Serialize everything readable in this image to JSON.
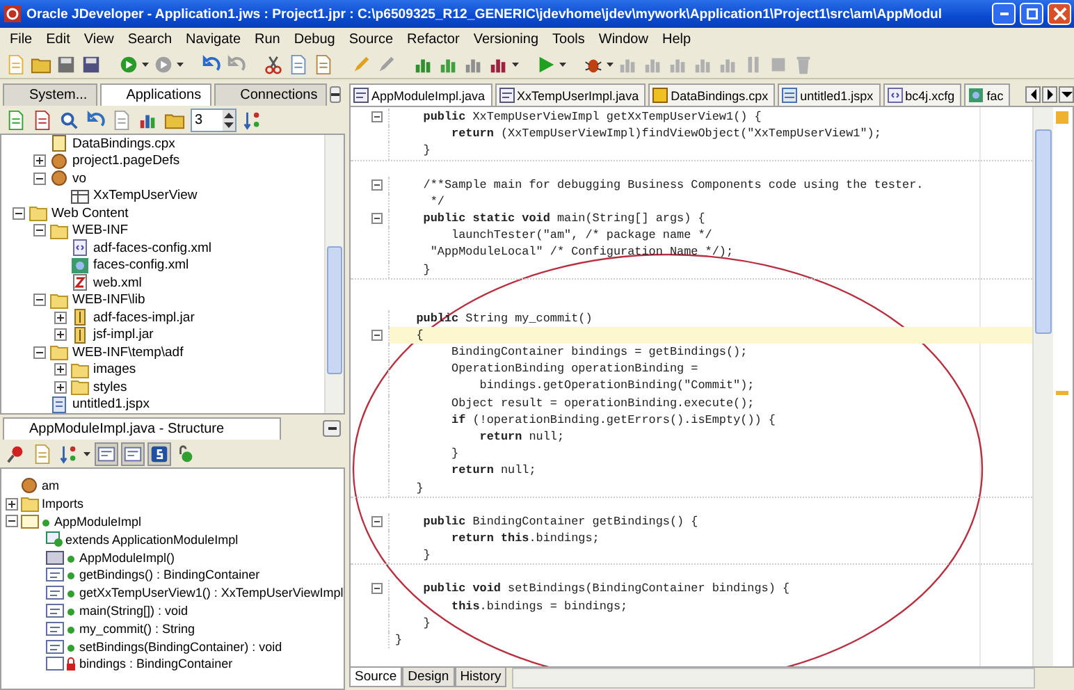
{
  "window": {
    "title": "Oracle JDeveloper - Application1.jws : Project1.jpr : C:\\p6509325_R12_GENERIC\\jdevhome\\jdev\\mywork\\Application1\\Project1\\src\\am\\AppModul"
  },
  "menu": [
    "File",
    "Edit",
    "View",
    "Search",
    "Navigate",
    "Run",
    "Debug",
    "Source",
    "Refactor",
    "Versioning",
    "Tools",
    "Window",
    "Help"
  ],
  "navigator": {
    "tabs": [
      {
        "label": "System...",
        "selected": false
      },
      {
        "label": "Applications",
        "selected": true
      },
      {
        "label": "Connections",
        "selected": false
      }
    ],
    "level_field": {
      "value": "3"
    },
    "tree": {
      "partial_branch": [
        {
          "label": "DataBindings.cpx",
          "kind": "file"
        },
        {
          "label": "project1.pageDefs",
          "kind": "package",
          "expanded": false
        },
        {
          "label": "vo",
          "kind": "package",
          "expanded": true,
          "children": [
            {
              "label": "XxTempUserView",
              "kind": "view"
            }
          ]
        }
      ],
      "items": [
        {
          "label": "Web Content",
          "kind": "folder",
          "expanded": true,
          "children": [
            {
              "label": "WEB-INF",
              "kind": "folder",
              "expanded": true,
              "children": [
                {
                  "label": "adf-faces-config.xml",
                  "kind": "xml"
                },
                {
                  "label": "faces-config.xml",
                  "kind": "faces"
                },
                {
                  "label": "web.xml",
                  "kind": "webxml"
                }
              ]
            },
            {
              "label": "WEB-INF\\lib",
              "kind": "folder",
              "expanded": true,
              "children": [
                {
                  "label": "adf-faces-impl.jar",
                  "kind": "jar",
                  "expanded": false
                },
                {
                  "label": "jsf-impl.jar",
                  "kind": "jar",
                  "expanded": false
                }
              ]
            },
            {
              "label": "WEB-INF\\temp\\adf",
              "kind": "folder",
              "expanded": true,
              "children": [
                {
                  "label": "images",
                  "kind": "folder",
                  "expanded": false
                },
                {
                  "label": "styles",
                  "kind": "folder",
                  "expanded": false
                }
              ]
            },
            {
              "label": "untitled1.jspx",
              "kind": "jspx"
            }
          ]
        }
      ]
    }
  },
  "structure": {
    "title": "AppModuleImpl.java - Structure",
    "tree": [
      {
        "label": "am",
        "kind": "package"
      },
      {
        "label": "Imports",
        "kind": "folder",
        "expanded": false
      },
      {
        "label": "AppModuleImpl",
        "kind": "class",
        "expanded": true,
        "children": [
          {
            "label": "extends ApplicationModuleImpl",
            "kind": "extends"
          },
          {
            "label": "AppModuleImpl()",
            "kind": "constructor"
          },
          {
            "label": "getBindings() : BindingContainer",
            "kind": "method"
          },
          {
            "label": "getXxTempUserView1() : XxTempUserViewImpl",
            "kind": "method"
          },
          {
            "label": "main(String[]) : void",
            "kind": "method"
          },
          {
            "label": "my_commit() : String",
            "kind": "method"
          },
          {
            "label": "setBindings(BindingContainer) : void",
            "kind": "method"
          },
          {
            "label": "bindings : BindingContainer",
            "kind": "field"
          }
        ]
      }
    ]
  },
  "editor": {
    "tabs": [
      {
        "label": "AppModuleImpl.java",
        "kind": "java",
        "selected": true
      },
      {
        "label": "XxTempUserImpl.java",
        "kind": "java",
        "selected": false
      },
      {
        "label": "DataBindings.cpx",
        "kind": "cpx",
        "selected": false
      },
      {
        "label": "untitled1.jspx",
        "kind": "jspx",
        "selected": false
      },
      {
        "label": "bc4j.xcfg",
        "kind": "xml",
        "selected": false
      },
      {
        "label": "fac",
        "kind": "faces",
        "selected": false
      }
    ],
    "blocks": [
      {
        "lines": [
          {
            "text": "    **public** XxTempUserViewImpl getXxTempUserView1() {",
            "fold": true,
            "highlighted": false
          },
          {
            "text": "        **return** (XxTempUserViewImpl)findViewObject(\"XxTempUserView1\");",
            "fold": false,
            "highlighted": false
          },
          {
            "text": "    }",
            "fold": false,
            "highlighted": false
          }
        ]
      },
      {
        "lines": [
          {
            "text": "    /**Sample main for debugging Business Components code using the tester.",
            "fold": true,
            "highlighted": false
          },
          {
            "text": "     */",
            "fold": false,
            "highlighted": false
          },
          {
            "text": "    **public static void** main(String[] args) {",
            "fold": true,
            "highlighted": false
          },
          {
            "text": "        launchTester(\"am\", /* package name */",
            "fold": false,
            "highlighted": false
          },
          {
            "text": "     \"AppModuleLocal\" /* Configuration Name */);",
            "fold": false,
            "highlighted": false
          },
          {
            "text": "    }",
            "fold": false,
            "highlighted": false
          }
        ]
      },
      {
        "lines": [
          {
            "text": "   **public** String my_commit()",
            "fold": false,
            "highlighted": false
          },
          {
            "text": "   {",
            "fold": true,
            "highlighted": true
          },
          {
            "text": "        BindingContainer bindings = getBindings();",
            "fold": false,
            "highlighted": false
          },
          {
            "text": "        OperationBinding operationBinding =",
            "fold": false,
            "highlighted": false
          },
          {
            "text": "            bindings.getOperationBinding(\"Commit\");",
            "fold": false,
            "highlighted": false
          },
          {
            "text": "        Object result = operationBinding.execute();",
            "fold": false,
            "highlighted": false
          },
          {
            "text": "        **if** (!operationBinding.getErrors().isEmpty()) {",
            "fold": false,
            "highlighted": false
          },
          {
            "text": "            **return** null;",
            "fold": false,
            "highlighted": false
          },
          {
            "text": "        }",
            "fold": false,
            "highlighted": false
          },
          {
            "text": "        **return** null;",
            "fold": false,
            "highlighted": false
          },
          {
            "text": "   }",
            "fold": false,
            "highlighted": false
          }
        ]
      },
      {
        "lines": [
          {
            "text": "    **public** BindingContainer getBindings() {",
            "fold": true,
            "highlighted": false
          },
          {
            "text": "        **return this**.bindings;",
            "fold": false,
            "highlighted": false
          },
          {
            "text": "    }",
            "fold": false,
            "highlighted": false
          }
        ]
      },
      {
        "lines": [
          {
            "text": "    **public void** setBindings(BindingContainer bindings) {",
            "fold": true,
            "highlighted": false
          },
          {
            "text": "        **this**.bindings = bindings;",
            "fold": false,
            "highlighted": false
          },
          {
            "text": "    }",
            "fold": false,
            "highlighted": false
          }
        ]
      }
    ],
    "closing_line": "}",
    "bottom_tabs": [
      {
        "label": "Source",
        "selected": true
      },
      {
        "label": "Design",
        "selected": false
      },
      {
        "label": "History",
        "selected": false
      }
    ]
  }
}
